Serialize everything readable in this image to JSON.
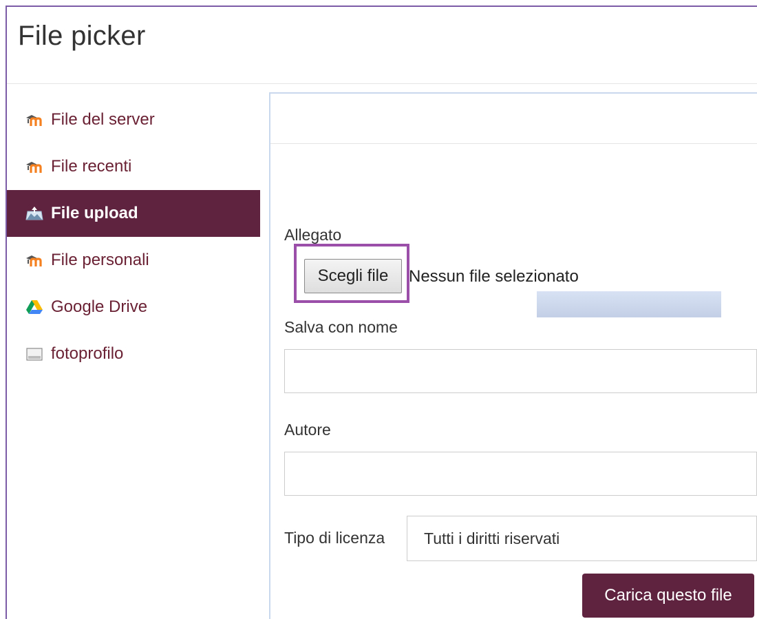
{
  "window": {
    "title": "File picker"
  },
  "sidebar": {
    "items": [
      {
        "label": "File del server",
        "icon": "moodle-icon",
        "active": false
      },
      {
        "label": "File recenti",
        "icon": "moodle-icon",
        "active": false
      },
      {
        "label": "File upload",
        "icon": "upload-icon",
        "active": true
      },
      {
        "label": "File personali",
        "icon": "moodle-icon",
        "active": false
      },
      {
        "label": "Google Drive",
        "icon": "google-drive-icon",
        "active": false
      },
      {
        "label": "fotoprofilo",
        "icon": "repository-icon",
        "active": false
      }
    ]
  },
  "form": {
    "attachment_label": "Allegato",
    "choose_button": "Scegli file",
    "no_file_text": "Nessun file selezionato",
    "save_as_label": "Salva con nome",
    "save_as_value": "",
    "author_label": "Autore",
    "author_value": "",
    "license_label": "Tipo di licenza",
    "license_value": "Tutti i diritti riservati",
    "upload_button": "Carica questo file"
  },
  "colors": {
    "accent": "#5f2340",
    "highlight": "#9b4fa9",
    "link": "#6a2134"
  }
}
